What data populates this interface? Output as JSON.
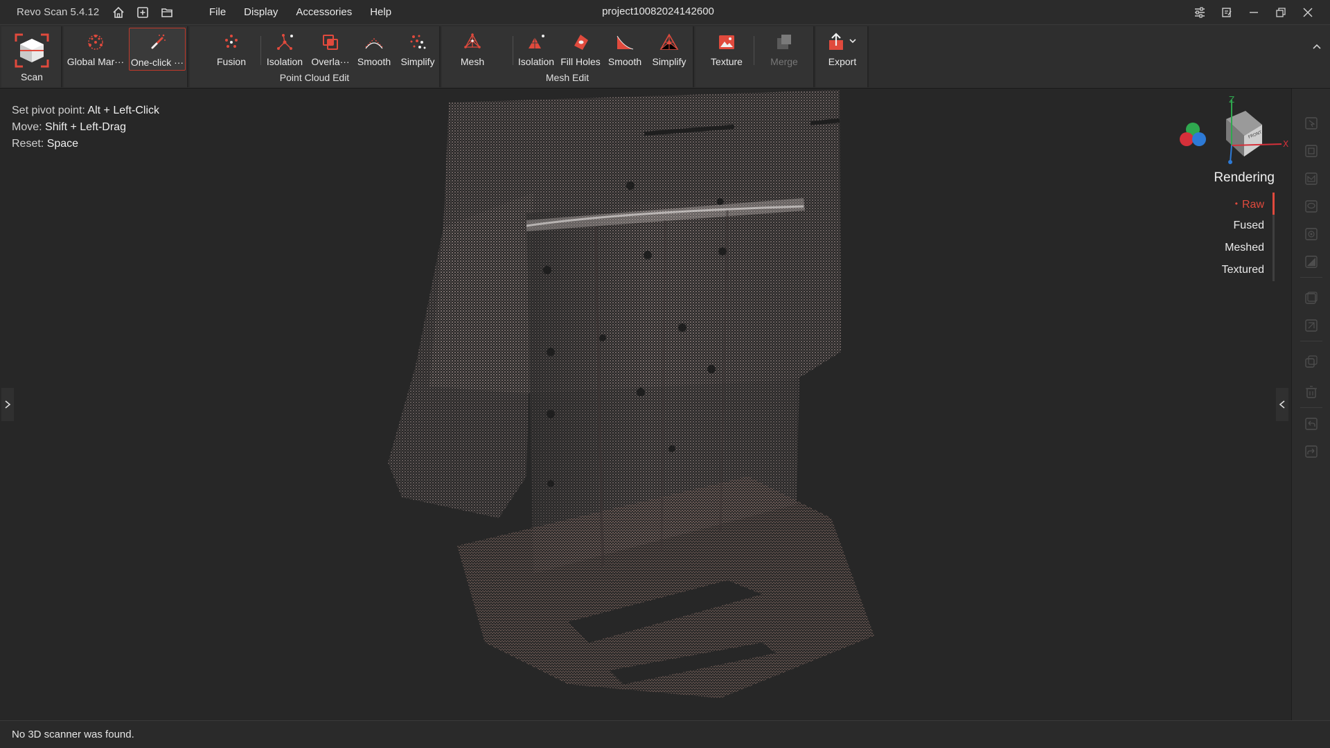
{
  "app": {
    "name": "Revo Scan 5.4.12",
    "document_title": "project10082024142600"
  },
  "menu": [
    "File",
    "Display",
    "Accessories",
    "Help"
  ],
  "ribbon": {
    "scan": "Scan",
    "global_markers": "Global Mar···",
    "one_click": "One-click ···",
    "fusion": "Fusion",
    "pc_isolation": "Isolation",
    "pc_overlap": "Overla···",
    "pc_smooth": "Smooth",
    "pc_simplify": "Simplify",
    "point_cloud_edit": "Point Cloud Edit",
    "mesh": "Mesh",
    "mesh_isolation": "Isolation",
    "fill_holes": "Fill Holes",
    "mesh_smooth": "Smooth",
    "mesh_simplify": "Simplify",
    "mesh_edit": "Mesh Edit",
    "texture": "Texture",
    "merge": "Merge",
    "export": "Export"
  },
  "hints": [
    {
      "label": "Set pivot point:",
      "keys": "Alt + Left-Click"
    },
    {
      "label": "Move:",
      "keys": "Shift + Left-Drag"
    },
    {
      "label": "Reset:",
      "keys": "Space"
    }
  ],
  "gizmo": {
    "z": "Z",
    "x": "X",
    "face": "FRONT"
  },
  "rendering": {
    "title": "Rendering",
    "options": [
      "Raw",
      "Fused",
      "Meshed",
      "Textured"
    ],
    "selected": "Raw"
  },
  "status": "No 3D scanner was found.",
  "colors": {
    "accent": "#e04a3d",
    "background": "#272727"
  }
}
